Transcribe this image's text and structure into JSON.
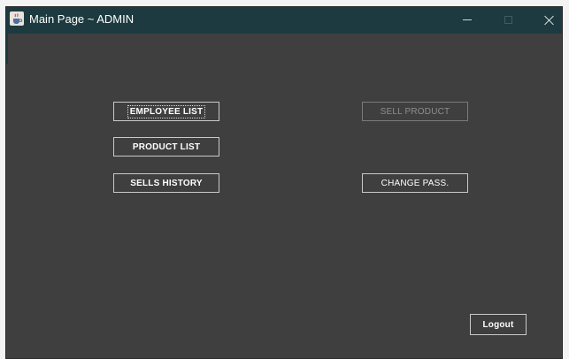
{
  "window": {
    "title": "Main Page ~ ADMIN",
    "app_icon": "java-cup-icon",
    "controls": {
      "minimize_icon": "minimize-icon",
      "maximize_icon": "maximize-icon",
      "close_icon": "close-icon"
    }
  },
  "menu": {
    "employee_list": "EMPLOYEE LIST",
    "product_list": "PRODUCT LIST",
    "sells_history": "SELLS HISTORY",
    "sell_product": "SELL PRODUCT",
    "change_pass": "CHANGE PASS."
  },
  "footer": {
    "logout": "Logout"
  },
  "colors": {
    "titlebar": "#1c3a3f",
    "background": "#3f3f3f",
    "text": "#ffffff",
    "border": "#c9c9c9",
    "disabled_text": "#8e8e8e"
  }
}
